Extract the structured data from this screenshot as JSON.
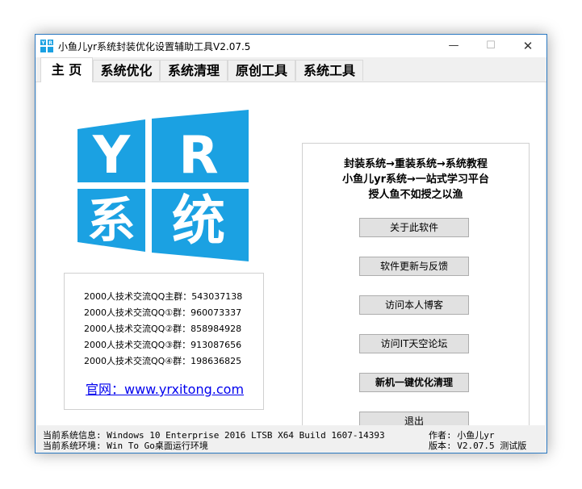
{
  "window": {
    "title": "小鱼儿yr系统封装优化设置辅助工具V2.07.5",
    "min_glyph": "—",
    "max_glyph": "☐",
    "close_glyph": "✕"
  },
  "tabs": [
    {
      "label": "主 页",
      "active": true
    },
    {
      "label": "系统优化",
      "active": false
    },
    {
      "label": "系统清理",
      "active": false
    },
    {
      "label": "原创工具",
      "active": false
    },
    {
      "label": "系统工具",
      "active": false
    }
  ],
  "logo": {
    "tiles": [
      "Y",
      "R",
      "系",
      "统"
    ],
    "color": "#1ba1e2"
  },
  "qq_groups": [
    "2000人技术交流QQ主群：543037138",
    "2000人技术交流QQ①群：960073337",
    "2000人技术交流QQ②群：858984928",
    "2000人技术交流QQ③群：913087656",
    "2000人技术交流QQ④群：198636825"
  ],
  "website": "官网：www.yrxitong.com",
  "slogans": [
    "封装系统→重装系统→系统教程",
    "小鱼儿yr系统→一站式学习平台",
    "授人鱼不如授之以渔"
  ],
  "buttons": {
    "about": "关于此软件",
    "update": "软件更新与反馈",
    "blog": "访问本人博客",
    "forum": "访问IT天空论坛",
    "optimize": "新机一键优化清理",
    "exit": "退出"
  },
  "status": {
    "sys_info": "当前系统信息: Windows 10 Enterprise 2016 LTSB X64 Build 1607-14393",
    "sys_env": "当前系统环境: Win To Go桌面运行环境",
    "author": "作者: 小鱼儿yr",
    "version": "版本: V2.07.5 测试版"
  }
}
